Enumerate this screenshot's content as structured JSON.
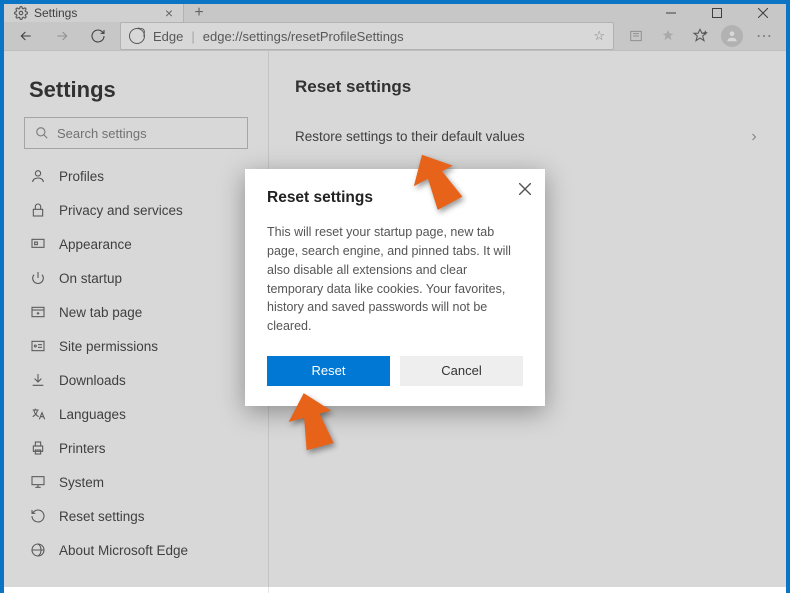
{
  "tab": {
    "title": "Settings"
  },
  "address": {
    "brand": "Edge",
    "url": "edge://settings/resetProfileSettings"
  },
  "sidebar": {
    "title": "Settings",
    "search_placeholder": "Search settings",
    "items": [
      {
        "label": "Profiles",
        "icon": "profile-icon"
      },
      {
        "label": "Privacy and services",
        "icon": "lock-icon"
      },
      {
        "label": "Appearance",
        "icon": "appearance-icon"
      },
      {
        "label": "On startup",
        "icon": "power-icon"
      },
      {
        "label": "New tab page",
        "icon": "newtab-icon"
      },
      {
        "label": "Site permissions",
        "icon": "permissions-icon"
      },
      {
        "label": "Downloads",
        "icon": "download-icon"
      },
      {
        "label": "Languages",
        "icon": "language-icon"
      },
      {
        "label": "Printers",
        "icon": "printer-icon"
      },
      {
        "label": "System",
        "icon": "system-icon"
      },
      {
        "label": "Reset settings",
        "icon": "reset-icon"
      },
      {
        "label": "About Microsoft Edge",
        "icon": "about-edge-icon"
      }
    ]
  },
  "main": {
    "title": "Reset settings",
    "row_label": "Restore settings to their default values"
  },
  "dialog": {
    "title": "Reset settings",
    "body": "This will reset your startup page, new tab page, search engine, and pinned tabs. It will also disable all extensions and clear temporary data like cookies. Your favorites, history and saved passwords will not be cleared.",
    "reset_label": "Reset",
    "cancel_label": "Cancel"
  }
}
